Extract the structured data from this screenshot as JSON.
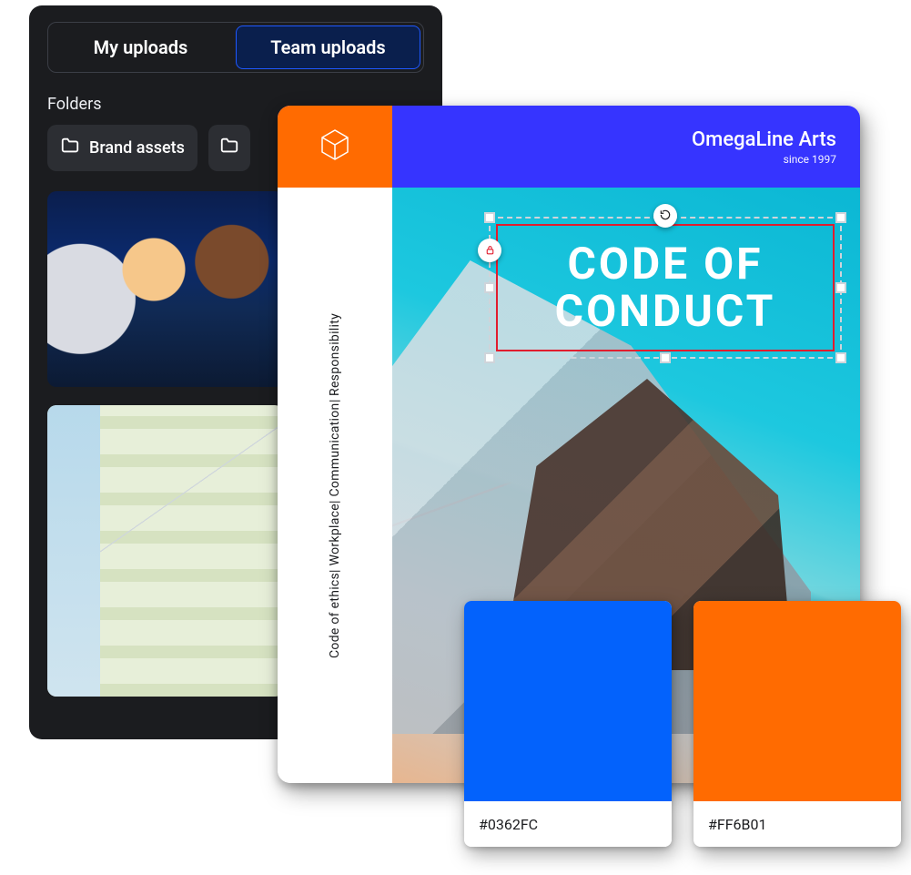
{
  "tabs": {
    "my_uploads": "My uploads",
    "team_uploads": "Team uploads"
  },
  "folders_label": "Folders",
  "folders": {
    "brand_assets": "Brand assets"
  },
  "document": {
    "brand_name": "OmegaLine Arts",
    "since": "since 1997",
    "title": "CODE OF\nCONDUCT",
    "rail_items": [
      "Code of ethics",
      "Workplace",
      "Communication",
      "Responsibility"
    ]
  },
  "swatches": [
    {
      "hex": "#0362FC"
    },
    {
      "hex": "#FF6B01"
    }
  ],
  "colors": {
    "brand_blue": "#3634ff",
    "brand_orange": "#ff6b01",
    "selection": "#e11d2e"
  }
}
